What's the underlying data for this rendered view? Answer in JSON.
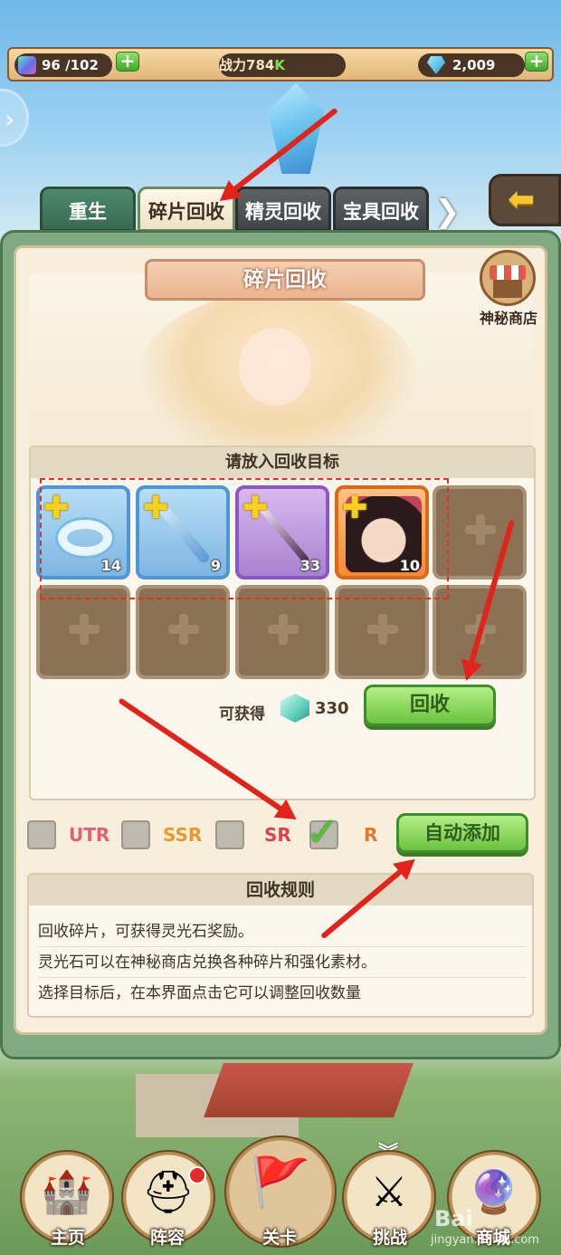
{
  "topbar": {
    "stamina": "96 /102",
    "power_label": "战力",
    "power_value": "784",
    "power_unit": "K",
    "diamonds": "2,009",
    "plus": "+"
  },
  "tabs": [
    {
      "label": "重生"
    },
    {
      "label": "碎片回收"
    },
    {
      "label": "精灵回收"
    },
    {
      "label": "宝具回收"
    }
  ],
  "tab_more": "❯",
  "back_icon": "⬅",
  "panel": {
    "title": "碎片回收",
    "shop_label": "神秘商店",
    "select_header": "请放入回收目标",
    "items": [
      {
        "rarity": "blue",
        "icon": "ring-icon",
        "count": "14"
      },
      {
        "rarity": "blue",
        "icon": "wand-icon",
        "count": "9"
      },
      {
        "rarity": "purple",
        "icon": "staff-icon",
        "count": "33"
      },
      {
        "rarity": "orange",
        "icon": "hero-portrait-icon",
        "count": "10"
      }
    ],
    "obtain_label": "可获得",
    "obtain_value": "330",
    "recycle_button": "回收",
    "filters": [
      {
        "label": "UTR",
        "color": "#e0607a",
        "checked": false
      },
      {
        "label": "SSR",
        "color": "#e89a2a",
        "checked": false
      },
      {
        "label": "SR",
        "color": "#e0424a",
        "checked": false
      },
      {
        "label": "R",
        "color": "#e07a28",
        "checked": true
      }
    ],
    "auto_add_button": "自动添加",
    "rules_header": "回收规则",
    "rules": [
      "回收碎片，可获得灵光石奖励。",
      "灵光石可以在神秘商店兑换各种碎片和强化素材。",
      "选择目标后，在本界面点击它可以调整回收数量"
    ]
  },
  "nav": [
    {
      "label": "主页",
      "icon": "castle-icon"
    },
    {
      "label": "阵容",
      "icon": "armor-icon"
    },
    {
      "label": "关卡",
      "icon": "flag-tower-icon"
    },
    {
      "label": "挑战",
      "icon": "shield-swords-icon"
    },
    {
      "label": "商城",
      "icon": "gumball-machine-icon"
    }
  ],
  "watermark": {
    "brand": "Bai",
    "sub": "jingyan.baidu.com"
  },
  "colors": {
    "annotation_red": "#e2231a",
    "button_green": "#6cc341"
  }
}
